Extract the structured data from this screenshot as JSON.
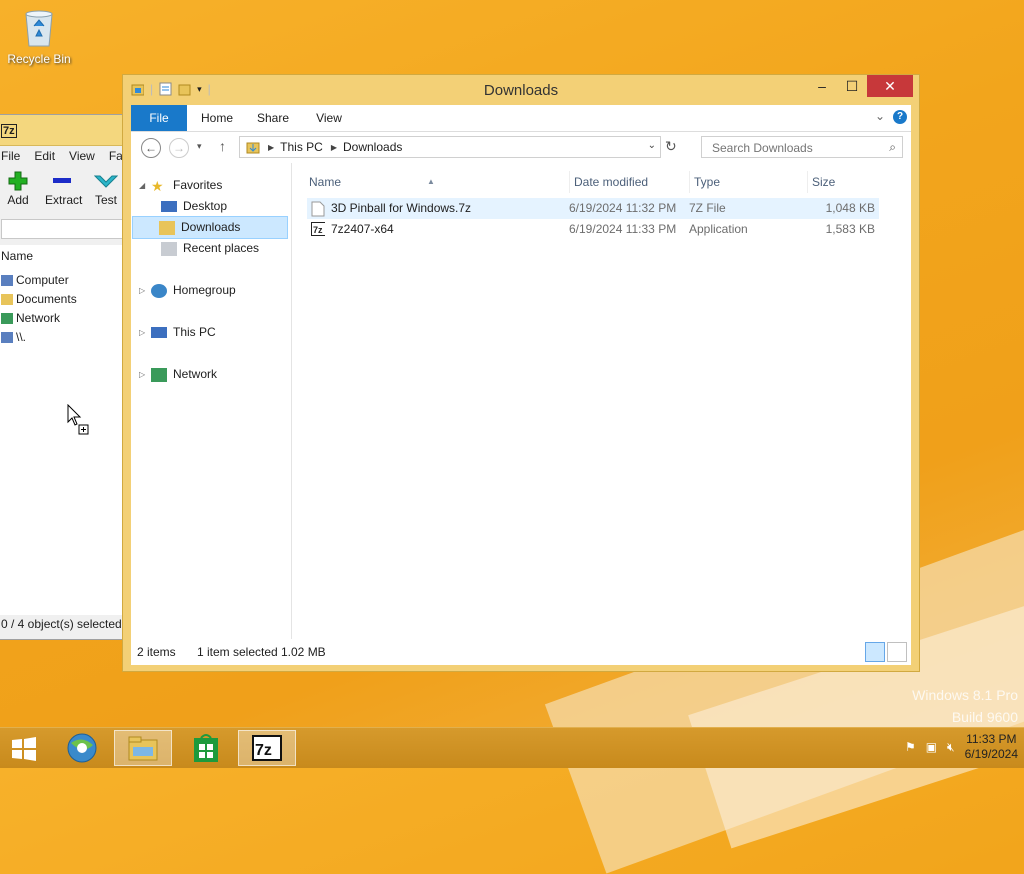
{
  "desktop": {
    "recycle_bin_label": "Recycle Bin"
  },
  "watermark": {
    "line1": "Windows 8.1 Pro",
    "line2": "Build 9600"
  },
  "zip_window": {
    "title_logo": "7z",
    "menu": [
      "File",
      "Edit",
      "View",
      "Fav"
    ],
    "toolbar": {
      "add": "Add",
      "extract": "Extract",
      "test": "Test"
    },
    "list_header": "Name",
    "items": [
      "Computer",
      "Documents",
      "Network",
      "\\\\."
    ],
    "status": "0 / 4 object(s) selected"
  },
  "explorer": {
    "title": "Downloads",
    "ribbon": {
      "file": "File",
      "home": "Home",
      "share": "Share",
      "view": "View",
      "help": "?"
    },
    "address": {
      "crumbs": [
        "This PC",
        "Downloads"
      ]
    },
    "search": {
      "placeholder": "Search Downloads"
    },
    "nav": {
      "favorites": "Favorites",
      "desktop": "Desktop",
      "downloads": "Downloads",
      "recent": "Recent places",
      "homegroup": "Homegroup",
      "thispc": "This PC",
      "network": "Network"
    },
    "columns": {
      "name": "Name",
      "date": "Date modified",
      "type": "Type",
      "size": "Size"
    },
    "files": [
      {
        "name": "3D Pinball for Windows.7z",
        "date": "6/19/2024 11:32 PM",
        "type": "7Z File",
        "size": "1,048 KB",
        "selected": true
      },
      {
        "name": "7z2407-x64",
        "date": "6/19/2024 11:33 PM",
        "type": "Application",
        "size": "1,583 KB",
        "selected": false
      }
    ],
    "status": {
      "count": "2 items",
      "selection": "1 item selected",
      "size": "1.02 MB"
    }
  },
  "taskbar": {
    "apps": [
      "7z"
    ],
    "clock": {
      "time": "11:33 PM",
      "date": "6/19/2024"
    }
  },
  "colors": {
    "accent": "#1979ca",
    "window_frame": "#f3d076",
    "close": "#c7383a",
    "selection": "#cce8ff"
  }
}
